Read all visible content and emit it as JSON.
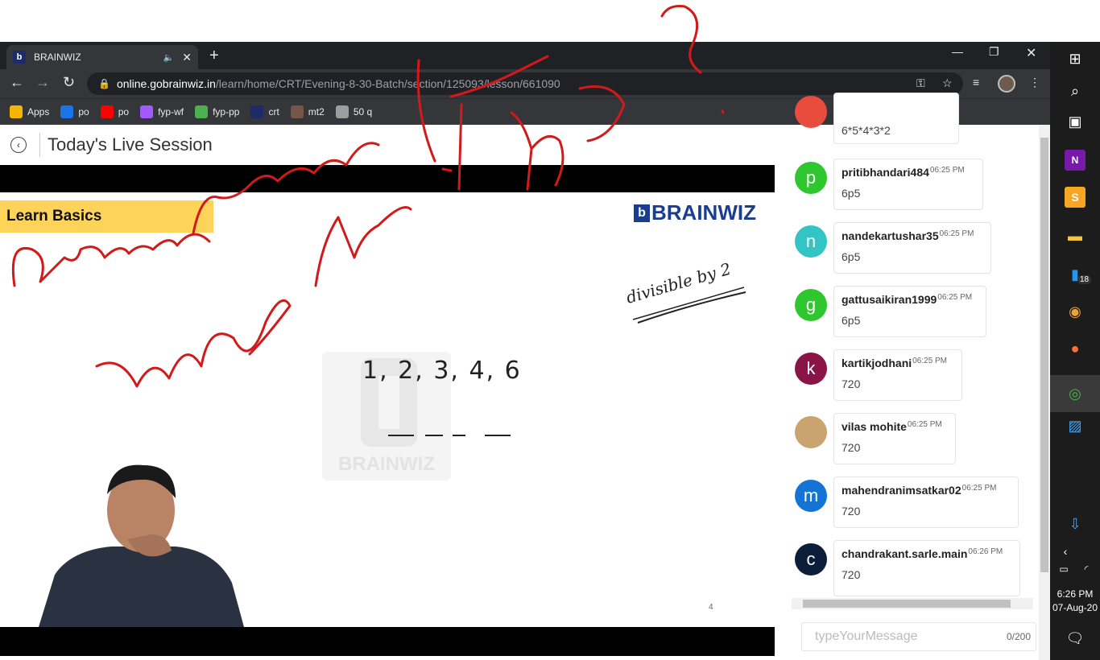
{
  "browser": {
    "tab_title": "BRAINWIZ",
    "favicon_letter": "b",
    "new_tab": "+",
    "url_host": "online.gobrainwiz.in",
    "url_path": "/learn/home/CRT/Evening-8-30-Batch/section/125093/lesson/661090"
  },
  "bookmarks": [
    {
      "label": "Apps",
      "icon": "apps-grid-icon",
      "color": "#f4b400"
    },
    {
      "label": "po",
      "icon": "edge-icon",
      "color": "#1a73e8"
    },
    {
      "label": "po",
      "icon": "youtube-icon",
      "color": "#ff0000"
    },
    {
      "label": "fyp-wf",
      "icon": "figma-icon",
      "color": "#a259ff"
    },
    {
      "label": "fyp-pp",
      "icon": "pdf-icon",
      "color": "#4caf50"
    },
    {
      "label": "crt",
      "icon": "brainwiz-icon",
      "color": "#1d2b6b"
    },
    {
      "label": "mt2",
      "icon": "cc-icon",
      "color": "#795548"
    },
    {
      "label": "50 q",
      "icon": "globe-icon",
      "color": "#9e9e9e"
    }
  ],
  "page": {
    "title": "Today's Live Session"
  },
  "slide": {
    "banner": "Learn Basics",
    "brand": "BRAINWIZ",
    "numbers": "1, 2, 3, 4, 6",
    "watermark": "BRAINWIZ",
    "page_number": "4"
  },
  "chat": {
    "partial_message": "6*5*4*3*2",
    "messages": [
      {
        "initial": "p",
        "color": "#2ec82e",
        "user": "pritibhandari484",
        "time": "06:25 PM",
        "text": "6p5"
      },
      {
        "initial": "n",
        "color": "#35c4c4",
        "user": "nandekartushar35",
        "time": "06:25 PM",
        "text": "6p5"
      },
      {
        "initial": "g",
        "color": "#2ec82e",
        "user": "gattusaikiran1999",
        "time": "06:25 PM",
        "text": "6p5"
      },
      {
        "initial": "k",
        "color": "#8a1446",
        "user": "kartikjodhani",
        "time": "06:25 PM",
        "text": "720"
      },
      {
        "initial": "",
        "color": "#c9a46e",
        "user": "vilas mohite",
        "time": "06:25 PM",
        "text": "720"
      },
      {
        "initial": "m",
        "color": "#1374d6",
        "user": "mahendranimsatkar02",
        "time": "06:25 PM",
        "text": "720"
      },
      {
        "initial": "c",
        "color": "#0c1e3a",
        "user": "chandrakant.sarle.main",
        "time": "06:26 PM",
        "text": "720"
      }
    ],
    "input_placeholder": "typeYourMessage",
    "counter": "0/200"
  },
  "taskbar": {
    "badge": "18",
    "time": "6:26 PM",
    "date": "07-Aug-20"
  }
}
